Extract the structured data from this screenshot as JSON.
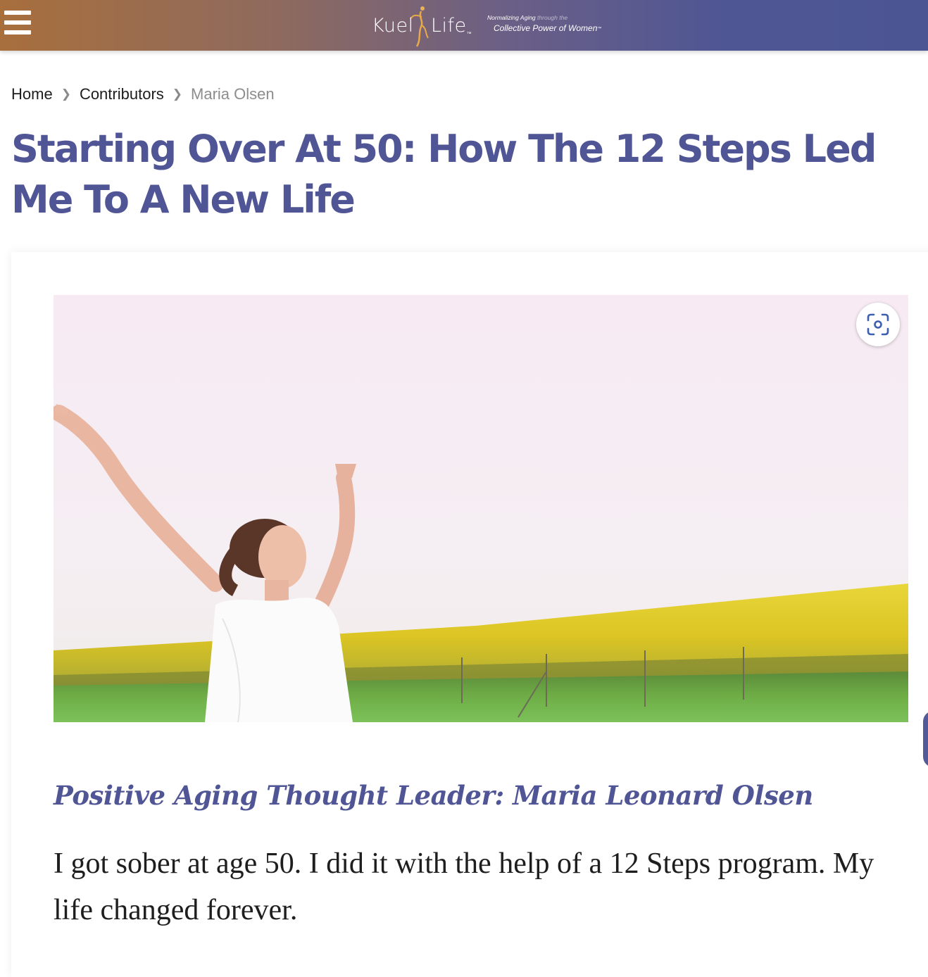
{
  "header": {
    "menu_icon": "hamburger-menu-icon",
    "logo": {
      "word1": "Kuel",
      "word2": "Life",
      "tm": "™"
    },
    "tagline": {
      "line1_a": "Normalizing Aging",
      "line1_b": "through the",
      "line2": "Collective Power of Women",
      "tm": "™"
    },
    "colors": {
      "gradient_start": "#a86f3d",
      "gradient_end": "#4c5594"
    }
  },
  "breadcrumb": {
    "items": [
      "Home",
      "Contributors"
    ],
    "current": "Maria Olsen",
    "separator_icon": "chevron-right-icon"
  },
  "article": {
    "title": "Starting Over At 50: How The 12 Steps Led Me To A New Life",
    "hero_image_alt": "Woman with arms raised in a yellow flower field",
    "visual_search_icon": "lens-search-icon",
    "byline": "Positive Aging Thought Leader: Maria Leonard Olsen",
    "intro": "I got sober at age 50. I did it with the help of a 12 Steps program. My life changed forever.",
    "accent_color": "#505595"
  }
}
